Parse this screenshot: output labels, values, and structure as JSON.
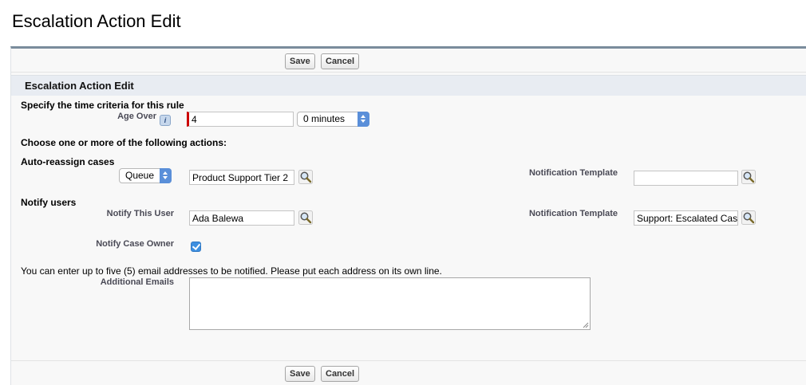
{
  "page": {
    "title": "Escalation Action Edit"
  },
  "buttons": {
    "save": "Save",
    "cancel": "Cancel"
  },
  "section": {
    "title": "Escalation Action Edit"
  },
  "time_criteria": {
    "heading": "Specify the time criteria for this rule",
    "age_over_label": "Age Over",
    "age_over_value": "4",
    "minutes_value": "0 minutes"
  },
  "actions": {
    "heading": "Choose one or more of the following actions:"
  },
  "reassign": {
    "heading": "Auto-reassign cases",
    "owner_type": "Queue",
    "owner_value": "Product Support Tier 2",
    "template_label": "Notification Template",
    "template_value": ""
  },
  "notify": {
    "heading": "Notify users",
    "user_label": "Notify This User",
    "user_value": "Ada Balewa",
    "template_label": "Notification Template",
    "template_value": "Support: Escalated Case",
    "owner_label": "Notify Case Owner",
    "owner_checked": true
  },
  "emails": {
    "instructions": "You can enter up to five (5) email addresses to be notified. Please put each address on its own line.",
    "label": "Additional Emails",
    "value": ""
  },
  "icons": {
    "lookup": "magnifier-lookup-icon",
    "info": "info-icon"
  },
  "colors": {
    "accent": "#5a8fd9",
    "required": "#cc0000",
    "header_bg": "#e8ecf2"
  }
}
